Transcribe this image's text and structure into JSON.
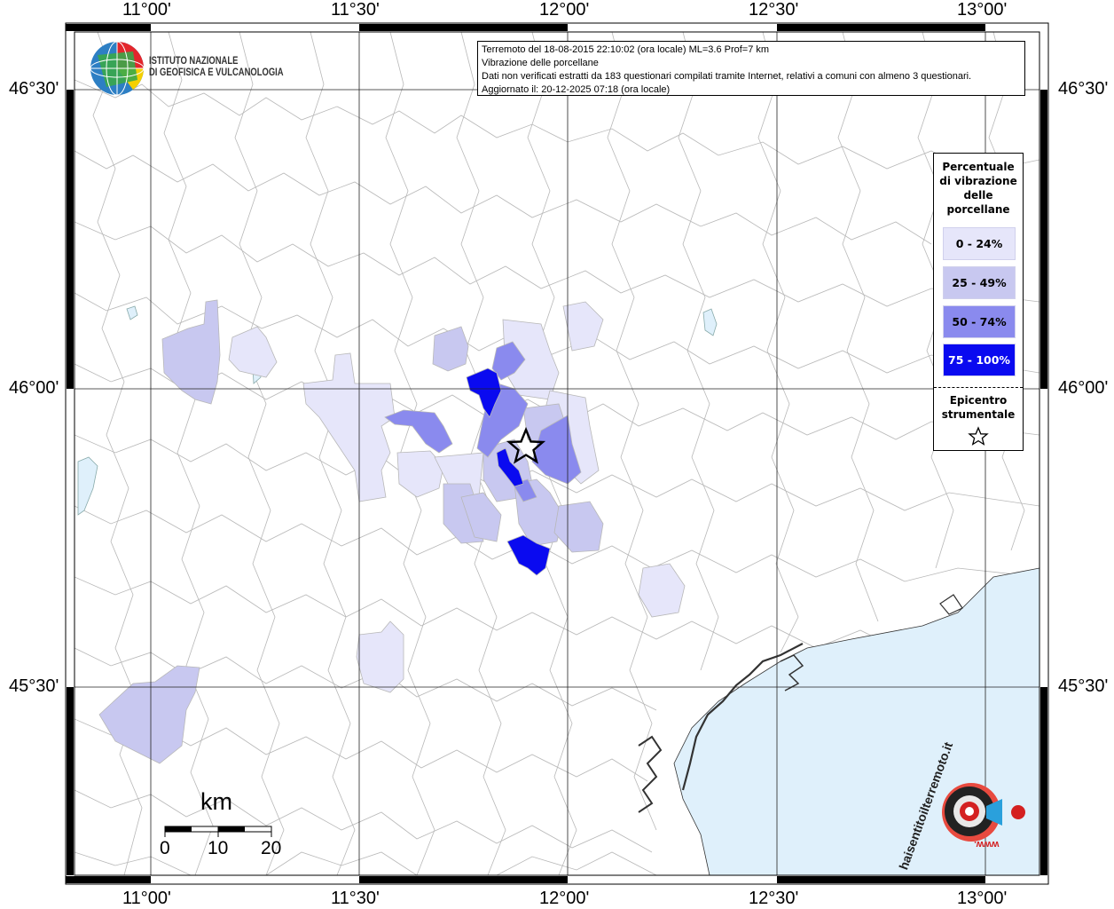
{
  "map": {
    "lon_labels": [
      "11°00'",
      "11°30'",
      "12°00'",
      "12°30'",
      "13°00'"
    ],
    "lat_labels": [
      "46°30'",
      "46°00'",
      "45°30'"
    ]
  },
  "info": {
    "line1": "Terremoto del 18-08-2015 22:10:02 (ora locale) ML=3.6 Prof=7 km",
    "line2": "Vibrazione delle porcellane",
    "line3": "Dati non verificati estratti da 183 questionari compilati tramite Internet, relativi a comuni con almeno 3 questionari.",
    "line4": "Aggiornato il: 20-12-2025 07:18 (ora locale)"
  },
  "logo": {
    "line1": "ISTITUTO NAZIONALE",
    "line2": "DI GEOFISICA E VULCANOLOGIA",
    "hst_text": "haisentitoilterremoto.it",
    "hst_url": "www."
  },
  "legend": {
    "title_lines": [
      "Percentuale",
      "di vibrazione",
      "delle",
      "porcellane"
    ],
    "items": [
      {
        "label": "0 - 24%",
        "color": "#e6e6fa",
        "text_color": "#000000"
      },
      {
        "label": "25 - 49%",
        "color": "#c8c8f0",
        "text_color": "#000000"
      },
      {
        "label": "50 - 74%",
        "color": "#8a8aee",
        "text_color": "#000000"
      },
      {
        "label": "75 - 100%",
        "color": "#0a0af0",
        "text_color": "#ffffff"
      }
    ],
    "epicenter_lines": [
      "Epicentro",
      "strumentale"
    ]
  },
  "scale": {
    "unit": "km",
    "labels": [
      "0",
      "10",
      "20"
    ]
  },
  "colors": {
    "sea": "#dff0fb",
    "border": "#b8b8b8",
    "grid": "#222222"
  }
}
